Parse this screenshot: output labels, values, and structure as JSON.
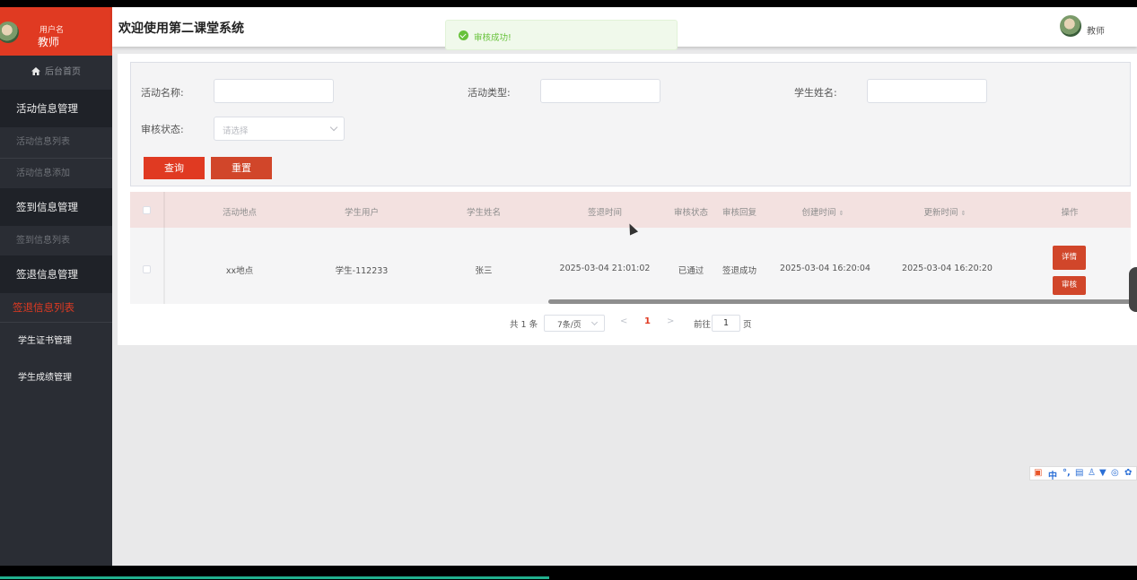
{
  "sidebar": {
    "user_label": "用户名",
    "role": "教师",
    "home": "后台首页",
    "groups": [
      {
        "label": "活动信息管理",
        "items": [
          "活动信息列表",
          "活动信息添加"
        ]
      },
      {
        "label": "签到信息管理",
        "items": [
          "签到信息列表"
        ]
      },
      {
        "label": "签退信息管理",
        "items": [
          "签退信息列表"
        ]
      }
    ],
    "extra": [
      "学生证书管理",
      "学生成绩管理"
    ]
  },
  "header": {
    "title": "欢迎使用第二课堂系统",
    "user": "教师"
  },
  "toast": {
    "text": "审核成功!",
    "color": "#67c23a"
  },
  "filter": {
    "activity_name_label": "活动名称:",
    "activity_type_label": "活动类型:",
    "student_name_label": "学生姓名:",
    "review_status_label": "审核状态:",
    "review_status_placeholder": "请选择",
    "query_button": "查询",
    "reset_button": "重置"
  },
  "table": {
    "columns": [
      "活动地点",
      "学生用户",
      "学生姓名",
      "签退时间",
      "审核状态",
      "审核回复",
      "创建时间",
      "更新时间",
      "操作"
    ],
    "rows": [
      {
        "location": "xx地点",
        "student_user": "学生-112233",
        "student_name": "张三",
        "signout_time": "2025-03-04 21:01:02",
        "review_status": "已通过",
        "review_reply": "签退成功",
        "created": "2025-03-04 16:20:04",
        "updated": "2025-03-04 16:20:20",
        "actions": [
          "详情",
          "审核"
        ]
      }
    ]
  },
  "pagination": {
    "total": "共 1 条",
    "page_size": "7条/页",
    "current_page": "1",
    "goto_prefix": "前往",
    "goto_value": "1",
    "goto_suffix": "页"
  },
  "colors": {
    "accent": "#e03a22",
    "sidebar_bg": "#2a2d34",
    "header_row": "#f3e1e0"
  }
}
